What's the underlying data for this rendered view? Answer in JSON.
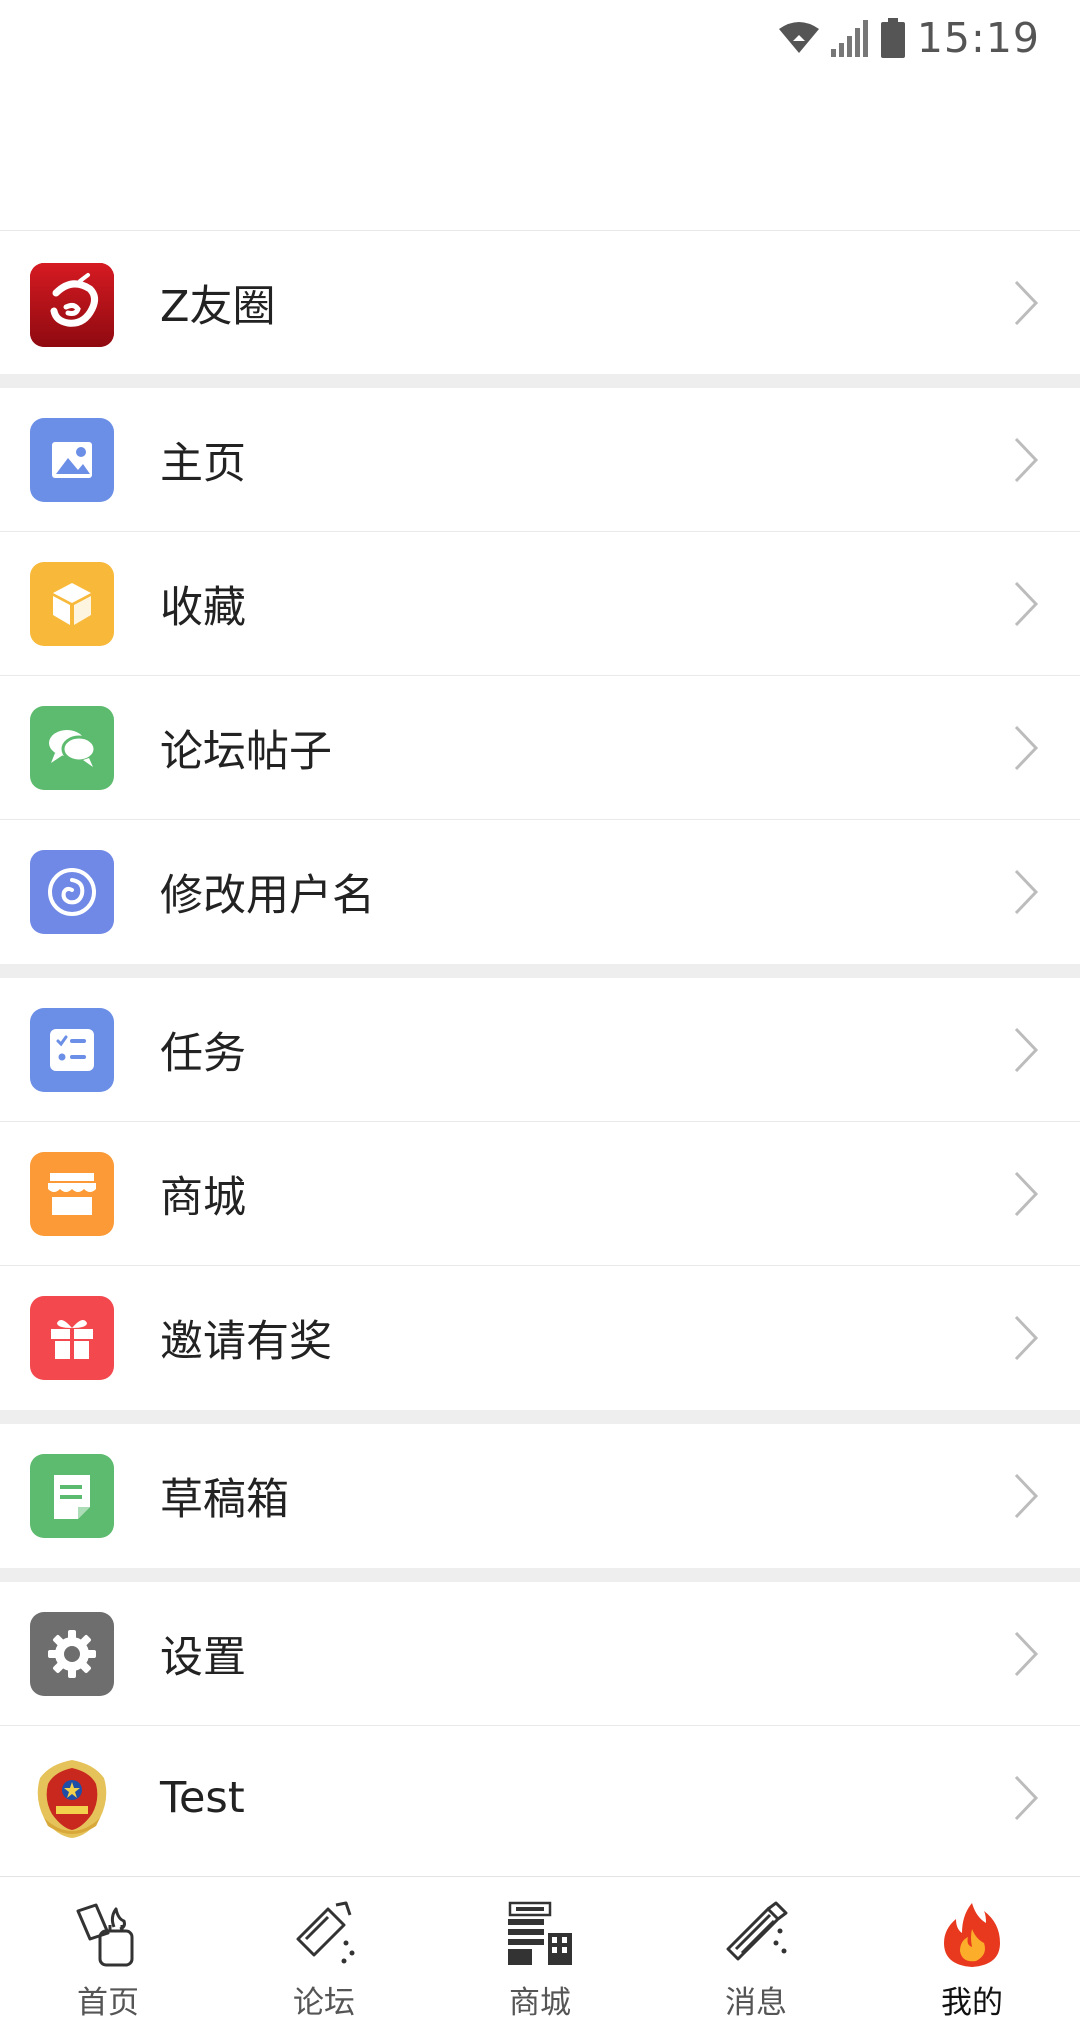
{
  "status_bar": {
    "time": "15:19",
    "icons": [
      "wifi-icon",
      "signal-icon",
      "battery-icon"
    ]
  },
  "menu_groups": [
    [
      {
        "label": "Z友圈",
        "icon": "zyouquan-logo-icon",
        "color": "#c0101a"
      }
    ],
    [
      {
        "label": "主页",
        "icon": "image-icon",
        "color": "#6b8ee6"
      },
      {
        "label": "收藏",
        "icon": "cube-icon",
        "color": "#f8b93b"
      },
      {
        "label": "论坛帖子",
        "icon": "chat-bubbles-icon",
        "color": "#5cbb6e"
      },
      {
        "label": "修改用户名",
        "icon": "spiral-icon",
        "color": "#7088e6"
      }
    ],
    [
      {
        "label": "任务",
        "icon": "task-list-icon",
        "color": "#6b8ee6"
      },
      {
        "label": "商城",
        "icon": "store-icon",
        "color": "#fb9a37"
      },
      {
        "label": "邀请有奖",
        "icon": "gift-icon",
        "color": "#f3484d"
      }
    ],
    [
      {
        "label": "草稿箱",
        "icon": "draft-note-icon",
        "color": "#5cbb6e"
      }
    ],
    [
      {
        "label": "设置",
        "icon": "gear-icon",
        "color": "#6e6e6e"
      },
      {
        "label": "Test",
        "icon": "police-emblem-avatar",
        "color": "#d8b63a"
      }
    ]
  ],
  "tabbar": {
    "tabs": [
      {
        "label": "首页",
        "icon": "home-lighter-icon",
        "active": false
      },
      {
        "label": "论坛",
        "icon": "forum-lighter-icon",
        "active": false
      },
      {
        "label": "商城",
        "icon": "store-building-icon",
        "active": false
      },
      {
        "label": "消息",
        "icon": "message-pen-icon",
        "active": false
      },
      {
        "label": "我的",
        "icon": "flame-icon",
        "active": true
      }
    ]
  }
}
